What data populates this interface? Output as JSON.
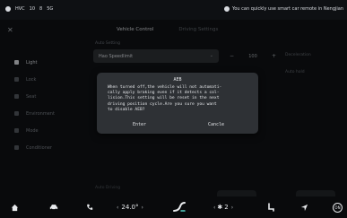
{
  "status_bar": {
    "left_items": [
      "HVC",
      "10",
      "8",
      "5G"
    ],
    "notice": "You can quickly use smart car remote in Nengjian"
  },
  "header": {
    "tabs": [
      {
        "label": "Vehicle Control",
        "active": true
      },
      {
        "label": "Driving Settings",
        "active": false
      }
    ]
  },
  "sidebar": {
    "items": [
      {
        "label": "Light",
        "active": true
      },
      {
        "label": "Lock",
        "active": false
      },
      {
        "label": "Seat",
        "active": false
      },
      {
        "label": "Environment",
        "active": false
      },
      {
        "label": "Mode",
        "active": false
      },
      {
        "label": "Conditioner",
        "active": false
      }
    ]
  },
  "content": {
    "section_label": "Auto Setting",
    "dropdown_value": "Hao Speedlimit",
    "stepper_minus": "−",
    "stepper_value": "100",
    "stepper_plus": "+",
    "side_option_1": "Deceleration",
    "side_option_2": "Auto hold",
    "bottom_label": "Auto Driving"
  },
  "dialog": {
    "title": "AEB",
    "lines": [
      "When turned off,the vehicle will not automati-",
      "cally apply braking even if it detects a col-",
      "lision.This setting will be reset in the next",
      "driving position cycle.Are you sure you want",
      "to disable AEB?"
    ],
    "confirm_label": "Enter",
    "cancel_label": "Cancle"
  },
  "dock": {
    "temp_left_arrow": "‹",
    "temperature": "24.0°",
    "temp_right_arrow": "›",
    "fan_left_arrow": "‹",
    "fan_level": "2",
    "fan_right_arrow": "›",
    "power_label": "ON"
  }
}
